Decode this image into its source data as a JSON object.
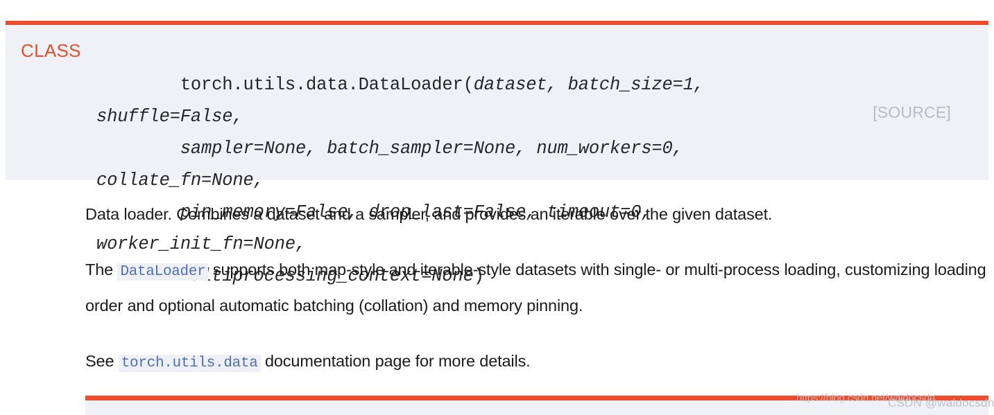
{
  "theme": {
    "accent": "#ee4c2c",
    "class_label_color": "#e2502a",
    "signature_bg": "#f0f1f6",
    "source_color": "#b8bbc4",
    "inline_code_color": "#4b6fbb",
    "inline_code_bg": "#eef0f5"
  },
  "signature": {
    "class_label": "CLASS",
    "qualified_name": "torch.utils.data.DataLoader(",
    "params_line1": "dataset, batch_size=1, shuffle=False,",
    "params_line2": "sampler=None, batch_sampler=None, num_workers=0, collate_fn=None,",
    "params_line3": "pin_memory=False, drop_last=False, timeout=0, worker_init_fn=None,",
    "params_line4": "multiprocessing_context=None",
    "close_paren": ")",
    "source_link": "[SOURCE]"
  },
  "body": {
    "paragraph1": "Data loader. Combines a dataset and a sampler, and provides an iterable over the given dataset.",
    "paragraph2": {
      "before_code": "The ",
      "code": "DataLoader",
      "after_code": " supports both map-style and iterable-style datasets with single- or multi-process loading, customizing loading order and optional automatic batching (collation) and memory pinning."
    },
    "paragraph3": {
      "before_code": "See ",
      "code": "torch.utils.data",
      "after_code": " documentation page for more details."
    }
  },
  "watermark": {
    "url": "https://blog.csdn.net/waldocsdn",
    "user": "CSDN @waldocsdn"
  }
}
